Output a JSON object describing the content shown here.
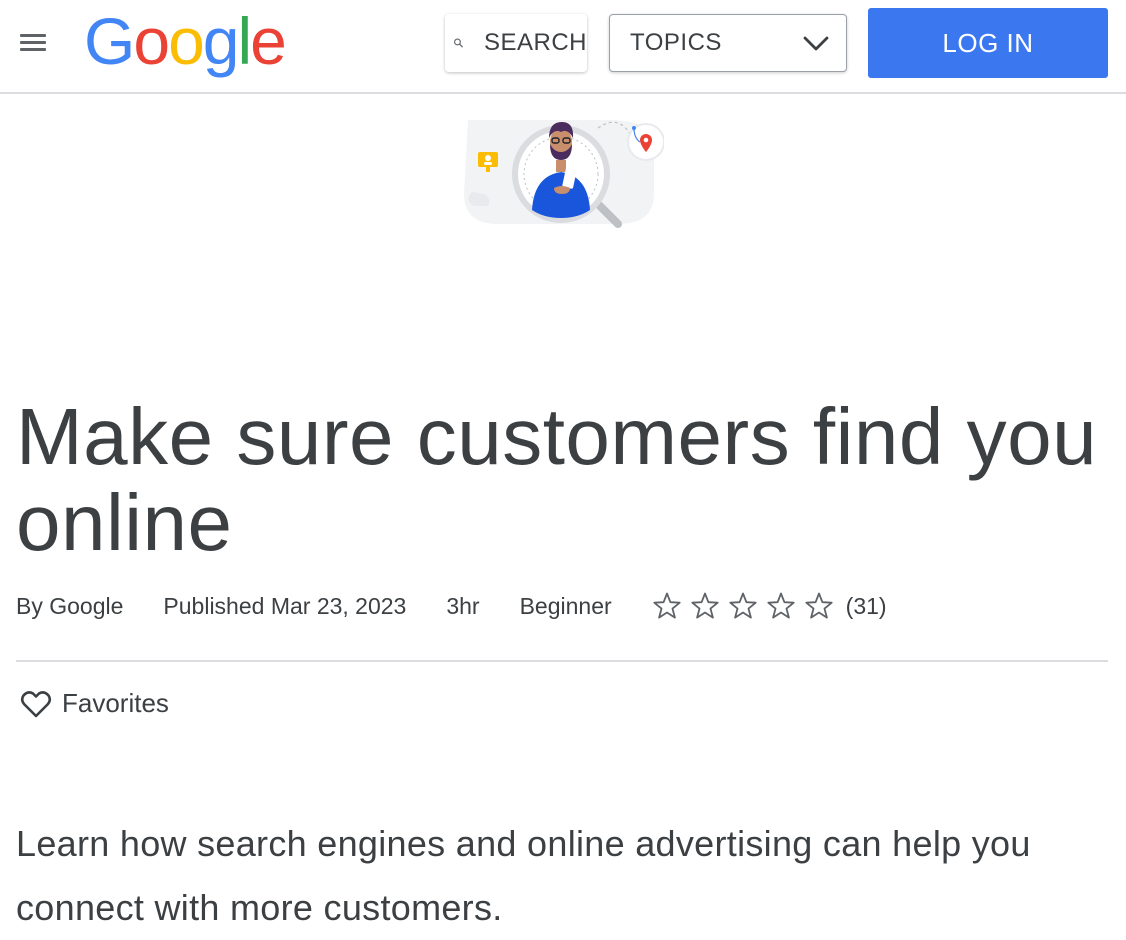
{
  "header": {
    "logo_letters": [
      {
        "ch": "G",
        "color": "#4285f4"
      },
      {
        "ch": "o",
        "color": "#ea4335"
      },
      {
        "ch": "o",
        "color": "#fbbc05"
      },
      {
        "ch": "g",
        "color": "#4285f4"
      },
      {
        "ch": "l",
        "color": "#34a853"
      },
      {
        "ch": "e",
        "color": "#ea4335"
      }
    ],
    "search_label": "SEARCH",
    "topics_label": "TOPICS",
    "login_label": "LOG IN"
  },
  "article": {
    "title": "Make sure customers find you online",
    "author": "By Google",
    "published": "Published Mar 23, 2023",
    "duration": "3hr",
    "level": "Beginner",
    "rating": 0,
    "rating_max": 5,
    "rating_count": "(31)",
    "favorites_label": "Favorites",
    "description": "Learn how search engines and online advertising can help you connect with more customers."
  },
  "colors": {
    "accent": "#3b78f0",
    "text": "#3c4043",
    "divider": "#dadce0"
  },
  "icons": [
    "menu-icon",
    "search-icon",
    "chevron-down-icon",
    "star-outline-icon",
    "heart-outline-icon"
  ]
}
